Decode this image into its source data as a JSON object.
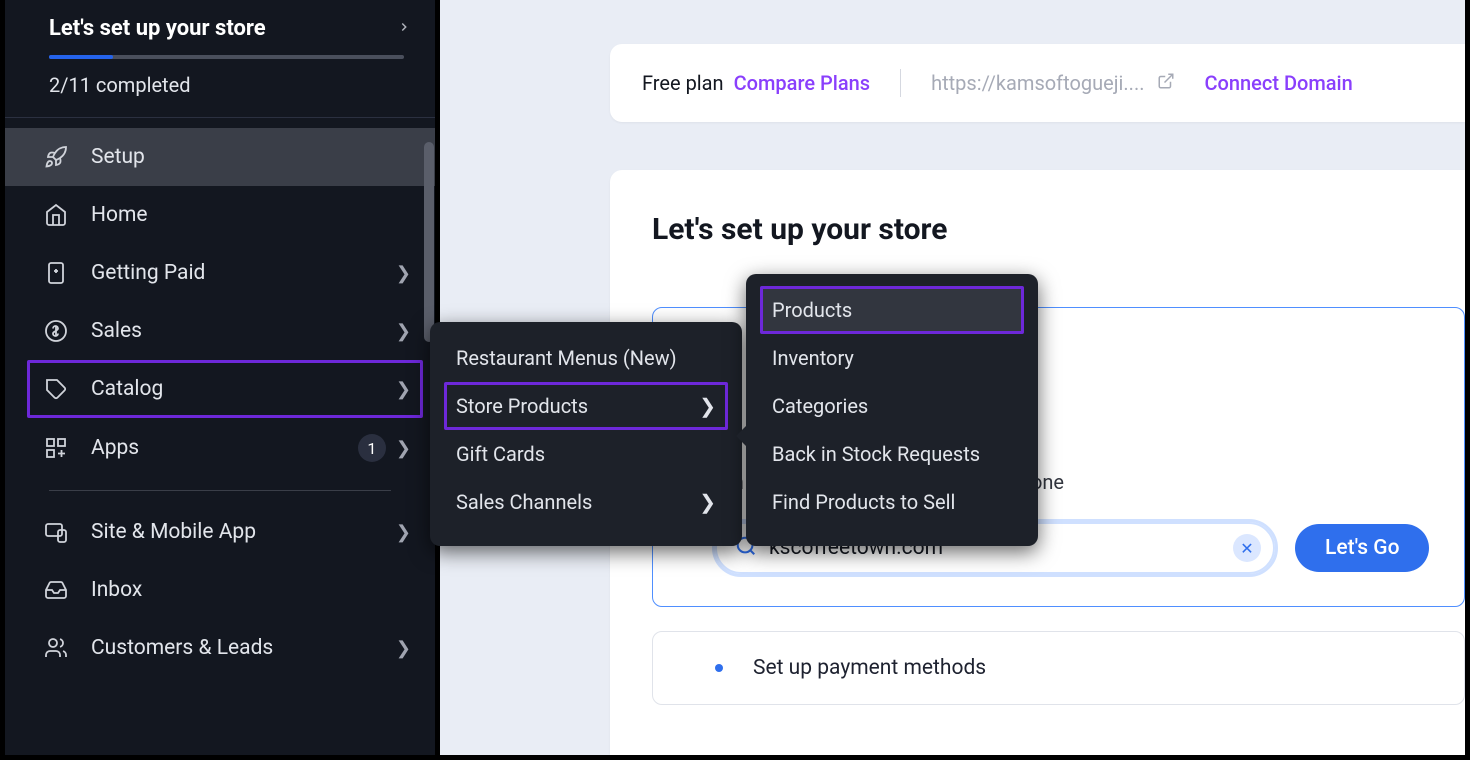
{
  "setup_header": {
    "title": "Let's set up your store",
    "completed_text": "2/11 completed",
    "progress_percent": 18
  },
  "sidebar": {
    "items": [
      {
        "label": "Setup",
        "icon": "rocket",
        "has_chevron": false,
        "active": true
      },
      {
        "label": "Home",
        "icon": "home",
        "has_chevron": false
      },
      {
        "label": "Getting Paid",
        "icon": "phone-money",
        "has_chevron": true
      },
      {
        "label": "Sales",
        "icon": "dollar-circle",
        "has_chevron": true
      },
      {
        "label": "Catalog",
        "icon": "tag",
        "has_chevron": true,
        "highlighted": true
      },
      {
        "label": "Apps",
        "icon": "grid-plus",
        "has_chevron": true,
        "badge": "1"
      },
      {
        "label": "Site & Mobile App",
        "icon": "devices",
        "has_chevron": true
      },
      {
        "label": "Inbox",
        "icon": "inbox",
        "has_chevron": false
      },
      {
        "label": "Customers & Leads",
        "icon": "people",
        "has_chevron": true
      }
    ]
  },
  "flyout1": {
    "items": [
      {
        "label": "Restaurant Menus (New)",
        "has_chevron": false
      },
      {
        "label": "Store Products",
        "has_chevron": true,
        "highlighted": true
      },
      {
        "label": "Gift Cards",
        "has_chevron": false
      },
      {
        "label": "Sales Channels",
        "has_chevron": true
      }
    ]
  },
  "flyout2": {
    "items": [
      {
        "label": "Products",
        "highlighted": true,
        "active_bg": true
      },
      {
        "label": "Inventory"
      },
      {
        "label": "Categories"
      },
      {
        "label": "Back in Stock Requests"
      },
      {
        "label": "Find Products to Sell"
      }
    ]
  },
  "topbar": {
    "plan_label": "Free plan",
    "compare_label": "Compare Plans",
    "url_text": "https://kamsoftogueji....",
    "connect_label": "Connect Domain"
  },
  "main": {
    "heading": "Let's set up your store",
    "domain_desc_suffix": "ain yours or search for an available one",
    "domain_value": "kscoffeetown.com",
    "go_label": "Let's Go",
    "payment_label": "Set up payment methods"
  }
}
